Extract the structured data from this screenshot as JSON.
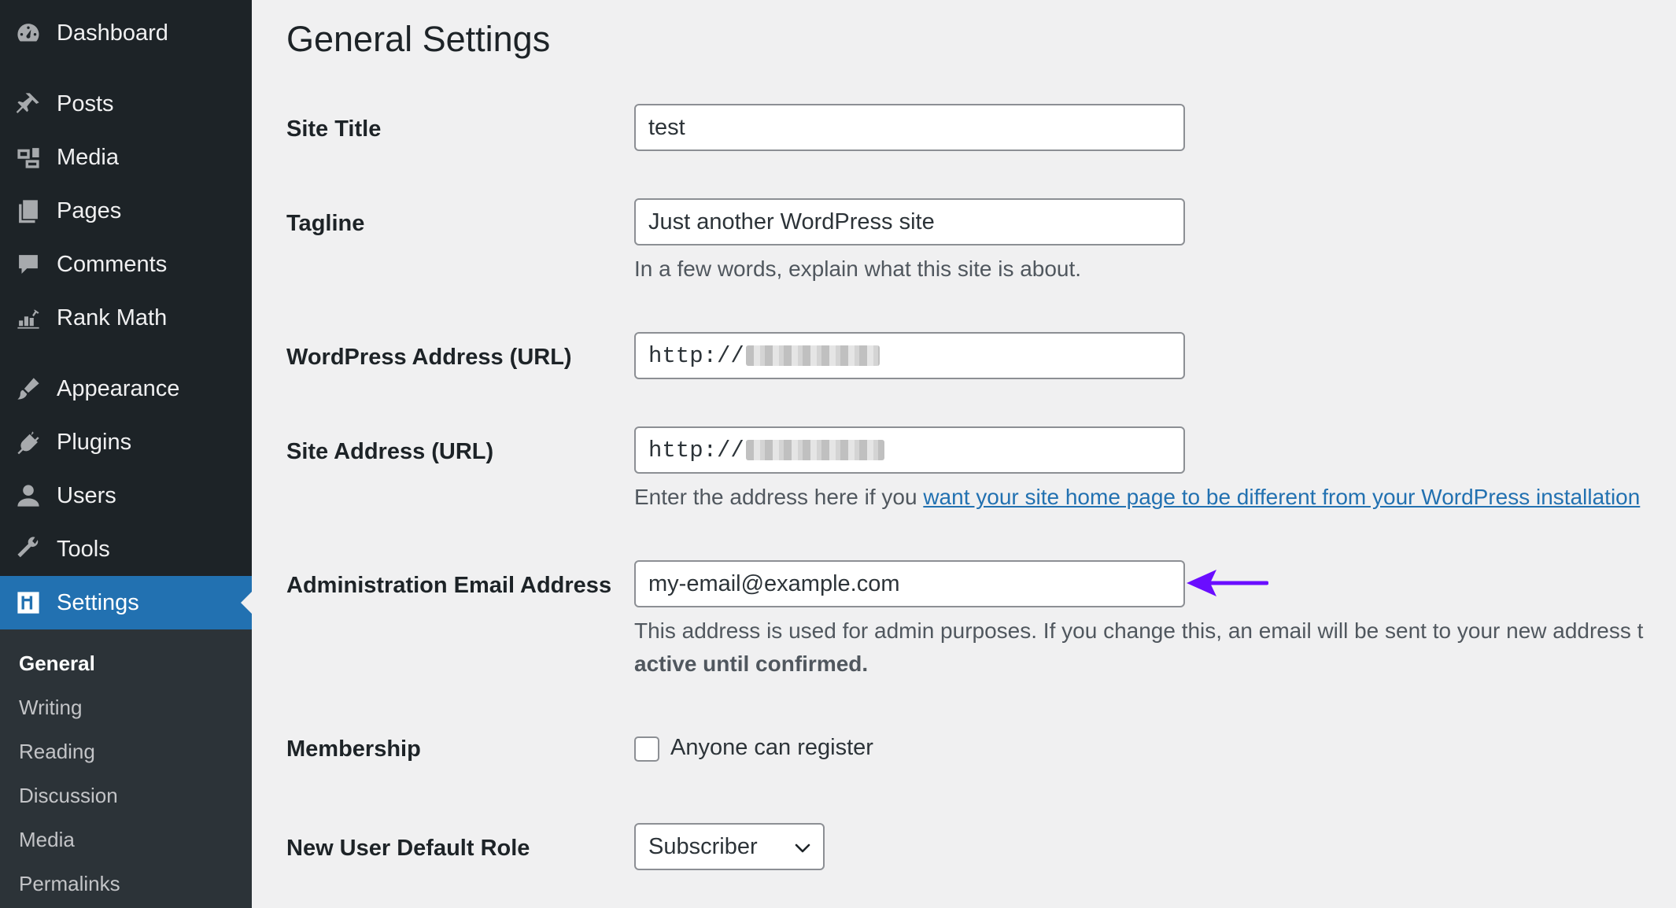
{
  "sidebar": {
    "items": [
      {
        "label": "Dashboard",
        "icon": "dashboard-icon"
      },
      {
        "label": "Posts",
        "icon": "pin-icon"
      },
      {
        "label": "Media",
        "icon": "media-icon"
      },
      {
        "label": "Pages",
        "icon": "pages-icon"
      },
      {
        "label": "Comments",
        "icon": "comment-icon"
      },
      {
        "label": "Rank Math",
        "icon": "rank-math-icon"
      },
      {
        "label": "Appearance",
        "icon": "brush-icon"
      },
      {
        "label": "Plugins",
        "icon": "plug-icon"
      },
      {
        "label": "Users",
        "icon": "user-icon"
      },
      {
        "label": "Tools",
        "icon": "wrench-icon"
      },
      {
        "label": "Settings",
        "icon": "settings-icon",
        "active": true
      }
    ],
    "submenu": [
      {
        "label": "General",
        "current": true
      },
      {
        "label": "Writing"
      },
      {
        "label": "Reading"
      },
      {
        "label": "Discussion"
      },
      {
        "label": "Media"
      },
      {
        "label": "Permalinks"
      }
    ]
  },
  "main": {
    "title": "General Settings",
    "site_title": {
      "label": "Site Title",
      "value": "test"
    },
    "tagline": {
      "label": "Tagline",
      "value": "Just another WordPress site",
      "description": "In a few words, explain what this site is about."
    },
    "wp_address": {
      "label": "WordPress Address (URL)",
      "value": "http://"
    },
    "site_address": {
      "label": "Site Address (URL)",
      "value": "http://",
      "description_prefix": "Enter the address here if you ",
      "description_link": "want your site home page to be different from your WordPress installation"
    },
    "admin_email": {
      "label": "Administration Email Address",
      "value": "my-email@example.com",
      "description": "This address is used for admin purposes. If you change this, an email will be sent to your new address t",
      "description_bold": "active until confirmed."
    },
    "membership": {
      "label": "Membership",
      "checkbox_label": "Anyone can register",
      "checked": false
    },
    "default_role": {
      "label": "New User Default Role",
      "selected": "Subscriber"
    }
  },
  "colors": {
    "sidebar_bg": "#1d2327",
    "submenu_bg": "#2c3338",
    "accent": "#2271b1",
    "page_bg": "#f0f0f1",
    "arrow": "#6a0dff"
  }
}
